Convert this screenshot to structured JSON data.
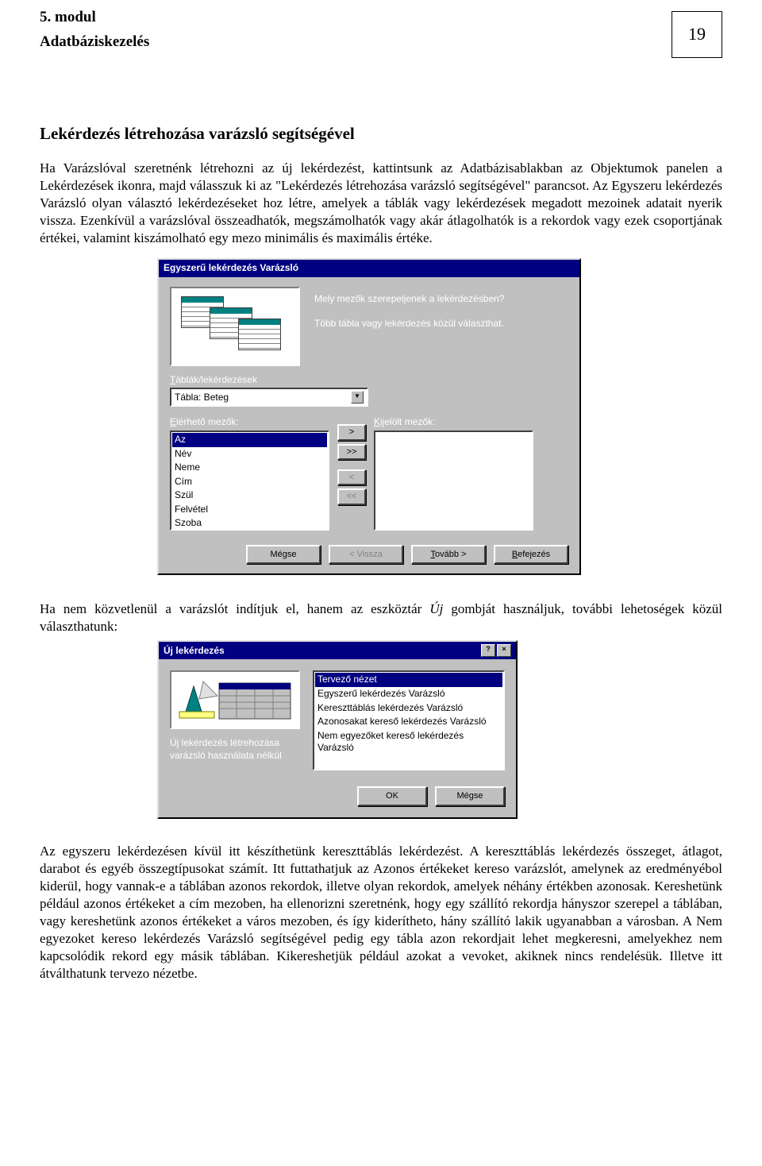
{
  "header": {
    "module_label": "5. modul",
    "module_title": "Adatbáziskezelés",
    "page_number": "19"
  },
  "section_title": "Lekérdezés létrehozása varázsló segítségével",
  "paragraph1": "Ha Varázslóval szeretnénk létrehozni az új lekérdezést, kattintsunk az Adatbázisablakban az Objektumok panelen a Lekérdezések ikonra, majd válasszuk ki az \"Lekérdezés létrehozása varázsló segítségével\" parancsot. Az Egyszeru lekérdezés Varázsló olyan választó lekérdezéseket hoz létre, amelyek a táblák vagy lekérdezések megadott mezoinek adatait nyerik vissza. Ezenkívül a varázslóval összeadhatók, megszámolhatók vagy akár átlagolhatók is a rekordok vagy ezek csoportjának értékei, valamint kiszámolható egy mezo minimális és maximális értéke.",
  "wizard": {
    "title": "Egyszerű lekérdezés Varázsló",
    "question": "Mely mezők szerepeljenek a lekérdezésben?",
    "hint": "Több tábla vagy lekérdezés közül választhat.",
    "tables_label": "Táblák/lekérdezések",
    "table_value": "Tábla: Beteg",
    "available_label": "Elérhető mezők:",
    "selected_label": "Kijelölt mezők:",
    "available_fields": [
      "Az",
      "Név",
      "Neme",
      "Cím",
      "Szül",
      "Felvétel",
      "Szoba"
    ],
    "selected_fields": [],
    "btn_add": ">",
    "btn_add_all": ">>",
    "btn_remove": "<",
    "btn_remove_all": "<<",
    "btn_cancel": "Mégse",
    "btn_back": "< Vissza",
    "btn_next": "Tovább >",
    "btn_finish": "Befejezés"
  },
  "paragraph2_a": "Ha nem közvetlenül a varázslót indítjuk el, hanem az eszköztár ",
  "paragraph2_italic": "Új",
  "paragraph2_b": " gombját használjuk, további lehetoségek közül választhatunk:",
  "newquery": {
    "title": "Új lekérdezés",
    "caption": "Új lekérdezés létrehozása varázsló használata nélkül",
    "options": [
      "Tervező nézet",
      "Egyszerű lekérdezés Varázsló",
      "Kereszttáblás lekérdezés Varázsló",
      "Azonosakat kereső lekérdezés Varázsló",
      "Nem egyezőket kereső lekérdezés Varázsló"
    ],
    "btn_ok": "OK",
    "btn_cancel": "Mégse"
  },
  "paragraph3": "Az egyszeru lekérdezésen kívül itt készíthetünk kereszttáblás lekérdezést. A kereszttáblás lekérdezés összeget, átlagot, darabot és egyéb összegtípusokat számít. Itt futtathatjuk az Azonos értékeket kereso varázslót, amelynek az eredményébol kiderül, hogy vannak-e a táblában azonos rekordok, illetve olyan rekordok, amelyek néhány értékben azonosak. Kereshetünk például azonos értékeket a cím mezoben, ha ellenorizni szeretnénk, hogy egy szállító rekordja hányszor szerepel a táblában, vagy kereshetünk azonos értékeket a város mezoben, és így kiderítheto, hány szállító lakik ugyanabban a városban. A Nem egyezoket kereso lekérdezés Varázsló segítségével pedig egy tábla azon rekordjait lehet megkeresni, amelyekhez nem kapcsolódik rekord egy másik táblában. Kikereshetjük például azokat a vevoket, akiknek nincs rendelésük. Illetve itt átválthatunk tervezo nézetbe."
}
